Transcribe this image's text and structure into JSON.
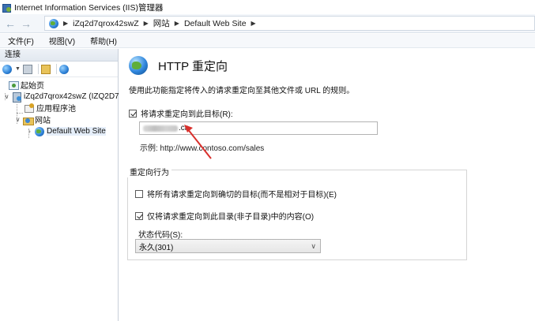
{
  "window": {
    "title": "Internet Information Services (IIS)管理器"
  },
  "address": {
    "crumbs": [
      "iZq2d7qrox42swZ",
      "网站",
      "Default Web Site"
    ]
  },
  "menu": {
    "items": [
      "文件(F)",
      "视图(V)",
      "帮助(H)"
    ]
  },
  "connections": {
    "header": "连接",
    "tree": {
      "start_page": "起始页",
      "server": "iZq2d7qrox42swZ (IZQ2D7",
      "app_pools": "应用程序池",
      "sites": "网站",
      "default_site": "Default Web Site"
    }
  },
  "main": {
    "title": "HTTP 重定向",
    "description": "使用此功能指定将传入的请求重定向至其他文件或 URL 的规则。",
    "redirect_checkbox": {
      "label": "将请求重定向到此目标(R):",
      "checked": true
    },
    "url_input": {
      "value_suffix": ".cn"
    },
    "example": "示例: http://www.contoso.com/sales",
    "behavior": {
      "group_title": "重定向行为",
      "exact_destination": {
        "label": "将所有请求重定向到确切的目标(而不是相对于目标)(E)",
        "checked": false
      },
      "only_this_dir": {
        "label": "仅将请求重定向到此目录(非子目录)中的内容(O)",
        "checked": true
      },
      "status_code_label": "状态代码(S):",
      "status_code_value": "永久(301)"
    }
  },
  "colors": {
    "arrow": "#d9302c",
    "selection": "#e5eef9"
  }
}
